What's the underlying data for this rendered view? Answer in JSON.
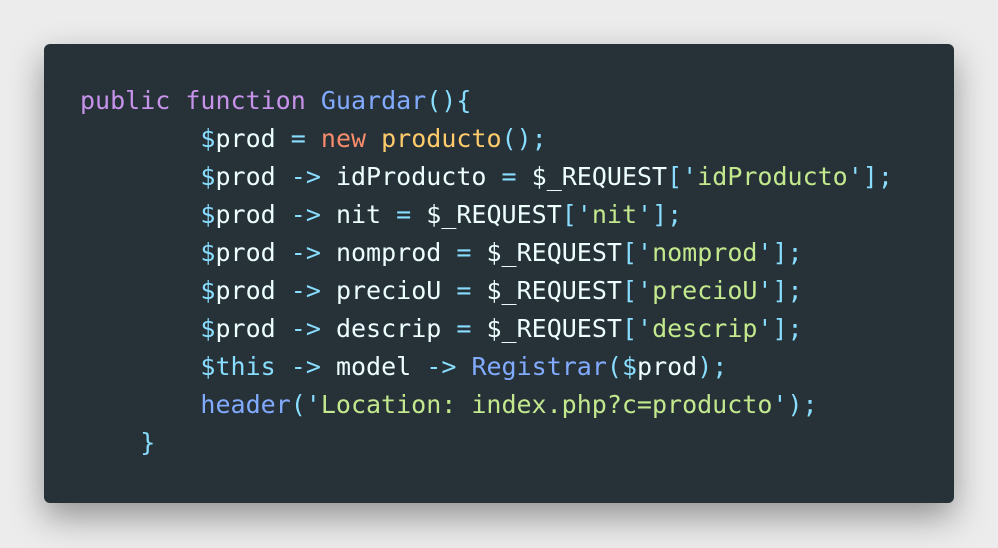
{
  "code": {
    "kw_public": "public",
    "kw_function": "function",
    "fn_name": "Guardar",
    "sigil": "$",
    "var_prod": "prod",
    "var_this": "this",
    "kw_new": "new",
    "class_name": "producto",
    "request": "$_REQUEST",
    "props": [
      "idProducto",
      "nit",
      "nomprod",
      "precioU",
      "descrip"
    ],
    "keys": [
      "idProducto",
      "nit",
      "nomprod",
      "precioU",
      "descrip"
    ],
    "model": "model",
    "method": "Registrar",
    "header_fn": "header",
    "header_arg": "Location: index.php?c=producto",
    "op_assign": "=",
    "op_arrow": "->",
    "close_brace": "}"
  }
}
